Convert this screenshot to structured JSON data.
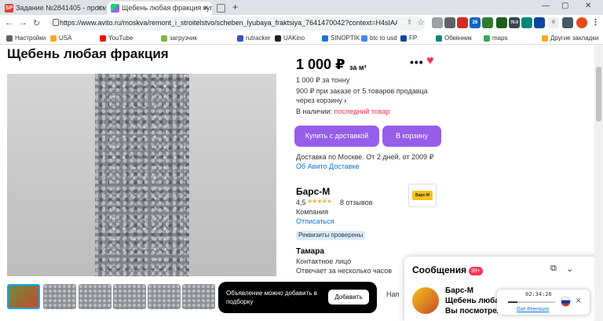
{
  "tabs": [
    {
      "favicon": "SP",
      "title": "Задание №2841405 - просмотр...",
      "active": false
    },
    {
      "favicon": "",
      "title": "Щебень любая фракция купить...",
      "active": true
    },
    {
      "favicon": "",
      "title": "",
      "active": false
    }
  ],
  "toolbar": {
    "url": "https://www.avito.ru/moskva/remont_i_stroitelstvo/scheben_lyubaya_fraktsiya_7641470042?context=H4sIAAAAAAAA_wE_...",
    "ext_badges": [
      "26",
      "LTC",
      "76.9"
    ]
  },
  "bookmarks": [
    "Настройки",
    "USA",
    "YouTube",
    "загрузчик",
    "rutracker",
    "UAKino",
    "SINOPTIK",
    "btc to usd",
    "FP",
    "Обмінник",
    "maps",
    "Другие закладки"
  ],
  "listing": {
    "title": "Щебень любая фракция",
    "price": "1 000 ₽",
    "price_unit": "за м³",
    "price_per_ton": "1 000 ₽ за тонну",
    "bulk_price_line1": "900 ₽ при заказе от 5 товаров продавца",
    "bulk_price_line2": "через корзину",
    "availability_label": "В наличии:",
    "availability_value": "последний товар",
    "buy_delivery_label": "Купить с доставкой",
    "cart_label": "В корзину",
    "delivery_text": "Доставка по Москве. От 2 дней, от 2009 ₽",
    "delivery_link": "Об Авито Доставке"
  },
  "seller": {
    "name": "Барс-М",
    "rating": "4,5",
    "stars": "★★★★★",
    "reviews": "8 отзывов",
    "type": "Компания",
    "subscribe": "Отписаться",
    "verified_badge": "Реквизиты проверены",
    "logo_text": "Барс-М"
  },
  "contact": {
    "name": "Тамара",
    "role": "Контактное лицо",
    "response": "Отвечает за несколько часов"
  },
  "toast": {
    "text": "Объявление можно добавить в подборку",
    "button": "Добавить",
    "side_text": "Нап"
  },
  "messages": {
    "title": "Сообщения",
    "count": "99+",
    "preview_line1": "Барс-М",
    "preview_line2": "Щебень любая ф",
    "preview_line3": "Вы посмотрели"
  },
  "player": {
    "time": "02:34:26",
    "progress": 0.2,
    "link": "Get Premium"
  },
  "colors": {
    "accent_purple": "#965eeb",
    "brand_red": "#ff3152",
    "link_blue": "#0a75d9"
  }
}
